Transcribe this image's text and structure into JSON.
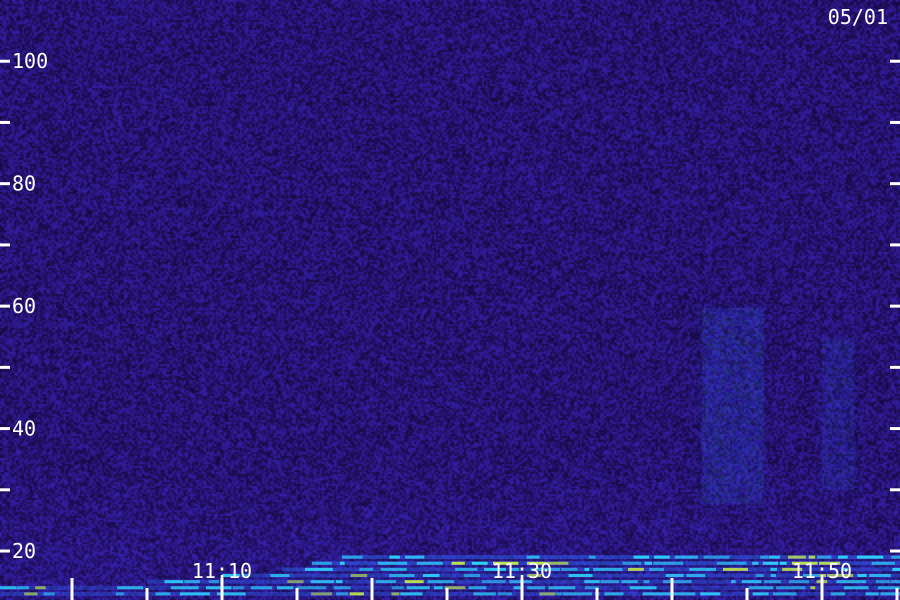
{
  "date_label": "05/01",
  "colors": {
    "background": "#1b0a52",
    "noise_low": "#14083a",
    "noise_high": "#3a22b8",
    "signal_mid": "#2f6bff",
    "signal_high": "#2fe0ff",
    "signal_peak": "#d8ff3a",
    "tick": "#ffffff"
  },
  "chart_data": {
    "type": "heatmap",
    "title": "",
    "xlabel": "",
    "ylabel": "",
    "ylim": [
      12,
      110
    ],
    "y_ticks": [
      {
        "value": 100,
        "label": "100"
      },
      {
        "value": 90,
        "label": ""
      },
      {
        "value": 80,
        "label": "80"
      },
      {
        "value": 70,
        "label": ""
      },
      {
        "value": 60,
        "label": "60"
      },
      {
        "value": 50,
        "label": ""
      },
      {
        "value": 40,
        "label": "40"
      },
      {
        "value": 30,
        "label": ""
      },
      {
        "value": 20,
        "label": "20"
      }
    ],
    "x_labels": [
      {
        "label": "11:10",
        "minute": 10
      },
      {
        "label": "11:30",
        "minute": 30
      },
      {
        "label": "11:50",
        "minute": 50
      }
    ],
    "x_ticks_minutes": [
      0,
      5,
      10,
      15,
      20,
      25,
      30,
      35,
      40,
      45,
      50,
      55
    ],
    "time_range_minutes": [
      -4.8,
      55.2
    ],
    "bands": [
      {
        "freq": 19,
        "start_minute": 18,
        "end_minute": 55.2,
        "intensity": 0.85
      },
      {
        "freq": 18,
        "start_minute": 16,
        "end_minute": 55.2,
        "intensity": 0.9
      },
      {
        "freq": 17,
        "start_minute": 14,
        "end_minute": 55.2,
        "intensity": 0.8
      },
      {
        "freq": 16,
        "start_minute": 10,
        "end_minute": 55.2,
        "intensity": 0.75
      },
      {
        "freq": 15,
        "start_minute": 5,
        "end_minute": 55.2,
        "intensity": 0.7
      },
      {
        "freq": 14,
        "start_minute": -4.8,
        "end_minute": 55.2,
        "intensity": 0.6
      },
      {
        "freq": 13,
        "start_minute": -4.8,
        "end_minute": 55.2,
        "intensity": 0.65
      }
    ],
    "enhancements": [
      {
        "freq_min": 28,
        "freq_max": 60,
        "start_minute": 42,
        "end_minute": 46,
        "intensity": 0.35
      },
      {
        "freq_min": 30,
        "freq_max": 55,
        "start_minute": 50,
        "end_minute": 52,
        "intensity": 0.25
      }
    ]
  }
}
